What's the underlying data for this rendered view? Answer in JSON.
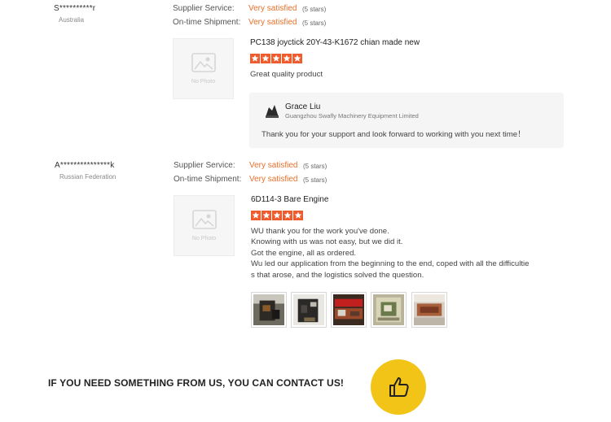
{
  "colors": {
    "accent": "#e8702a",
    "star": "#ee5b2c",
    "badge": "#f2c418"
  },
  "labels": {
    "supplier_service": "Supplier Service:",
    "on_time_shipment": "On-time Shipment:",
    "no_photo": "No Photo"
  },
  "reviews": [
    {
      "buyer": "S**********r",
      "country": "Australia",
      "supplier_rating": "Very satisfied",
      "supplier_stars": "(5 stars)",
      "shipment_rating": "Very satisfied",
      "shipment_stars": "(5 stars)",
      "product": "PC138 joyctick 20Y-43-K1672 chian made new",
      "rating": 5,
      "text": "Great quality product",
      "reply": {
        "name": "Grace Liu",
        "company": "Guangzhou Swafly Machinery Equipment Limited",
        "text": "Thank you for your support and look forward to working with you next time！"
      }
    },
    {
      "buyer": "A***************k",
      "country": "Russian Federation",
      "supplier_rating": "Very satisfied",
      "supplier_stars": "(5 stars)",
      "shipment_rating": "Very satisfied",
      "shipment_stars": "(5 stars)",
      "product": "6D114-3 Bare Engine",
      "rating": 5,
      "text": "WU thank you for the work you've done.\nKnowing with us was not easy, but we did it.\nGot the engine, all as ordered.\nWu led our application from the beginning to the end, coped with all the difficultie\ns that arose, and the logistics solved the question.",
      "photos": [
        "engine-photo-1",
        "engine-photo-2",
        "engine-photo-3",
        "engine-photo-4",
        "engine-photo-5"
      ]
    }
  ],
  "contact": {
    "text": "IF YOU NEED SOMETHING FROM US, YOU CAN CONTACT US!",
    "icon": "thumbs-up-icon"
  }
}
